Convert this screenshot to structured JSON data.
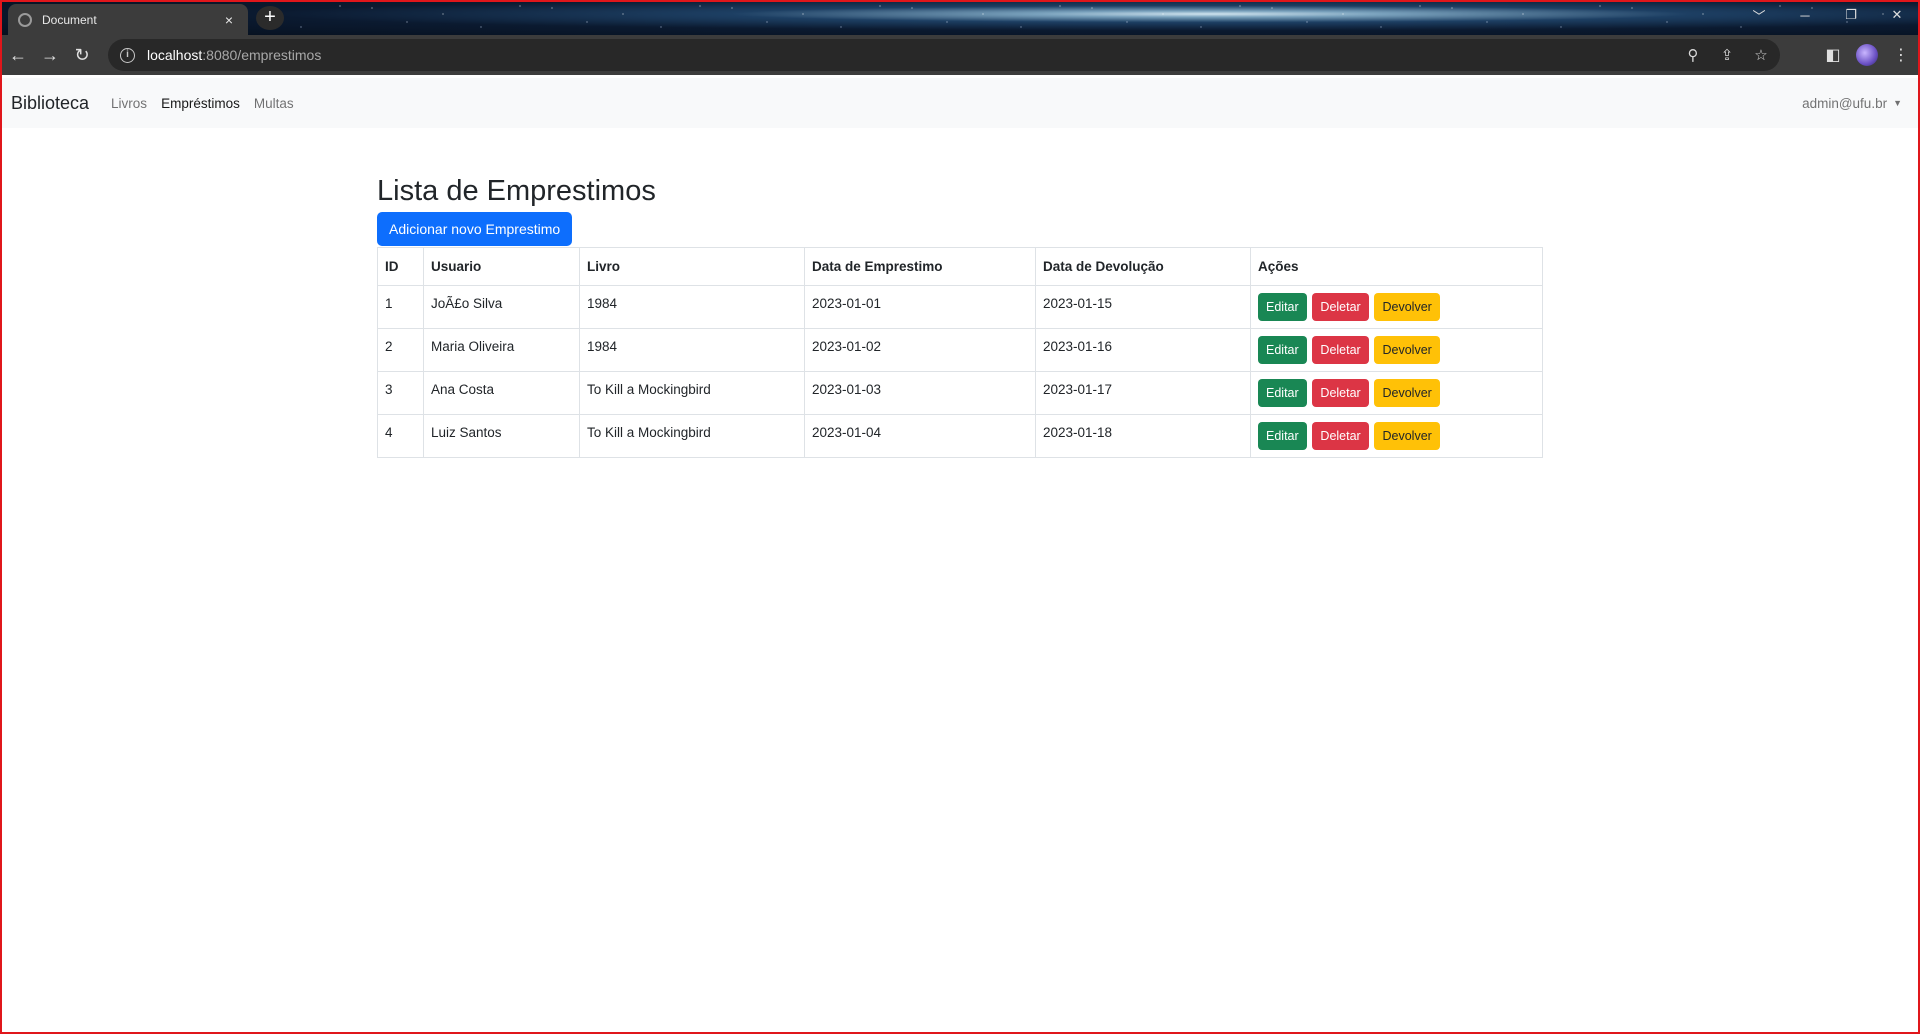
{
  "browser": {
    "tab_title": "Document",
    "tab_close": "×",
    "new_tab": "+",
    "url_host": "localhost",
    "url_rest": ":8080/emprestimos",
    "window_controls": [
      "﹀",
      "─",
      "❐",
      "✕"
    ],
    "icons": [
      "back-arrow-icon",
      "forward-arrow-icon",
      "reload-icon",
      "info-icon",
      "zoom-icon",
      "share-icon",
      "star-icon",
      "side-panel-icon",
      "profile-avatar",
      "menu-kebab-icon"
    ]
  },
  "navbar": {
    "brand": "Biblioteca",
    "links": [
      {
        "label": "Livros",
        "active": false
      },
      {
        "label": "Empréstimos",
        "active": true
      },
      {
        "label": "Multas",
        "active": false
      }
    ],
    "user": "admin@ufu.br"
  },
  "main": {
    "title": "Lista de Emprestimos",
    "add_button": "Adicionar novo Emprestimo",
    "columns": [
      "ID",
      "Usuario",
      "Livro",
      "Data de Emprestimo",
      "Data de Devolução",
      "Ações"
    ],
    "rows": [
      {
        "id": "1",
        "usuario": "JoÃ£o Silva",
        "livro": "1984",
        "emprestimo": "2023-01-01",
        "devolucao": "2023-01-15"
      },
      {
        "id": "2",
        "usuario": "Maria Oliveira",
        "livro": "1984",
        "emprestimo": "2023-01-02",
        "devolucao": "2023-01-16"
      },
      {
        "id": "3",
        "usuario": "Ana Costa",
        "livro": "To Kill a Mockingbird",
        "emprestimo": "2023-01-03",
        "devolucao": "2023-01-17"
      },
      {
        "id": "4",
        "usuario": "Luiz Santos",
        "livro": "To Kill a Mockingbird",
        "emprestimo": "2023-01-04",
        "devolucao": "2023-01-18"
      }
    ],
    "actions": {
      "edit": "Editar",
      "delete": "Deletar",
      "return": "Devolver"
    }
  },
  "colors": {
    "primary": "#0d6efd",
    "success": "#198754",
    "danger": "#dc3545",
    "warning": "#ffc107",
    "frame": "#e0161b"
  }
}
